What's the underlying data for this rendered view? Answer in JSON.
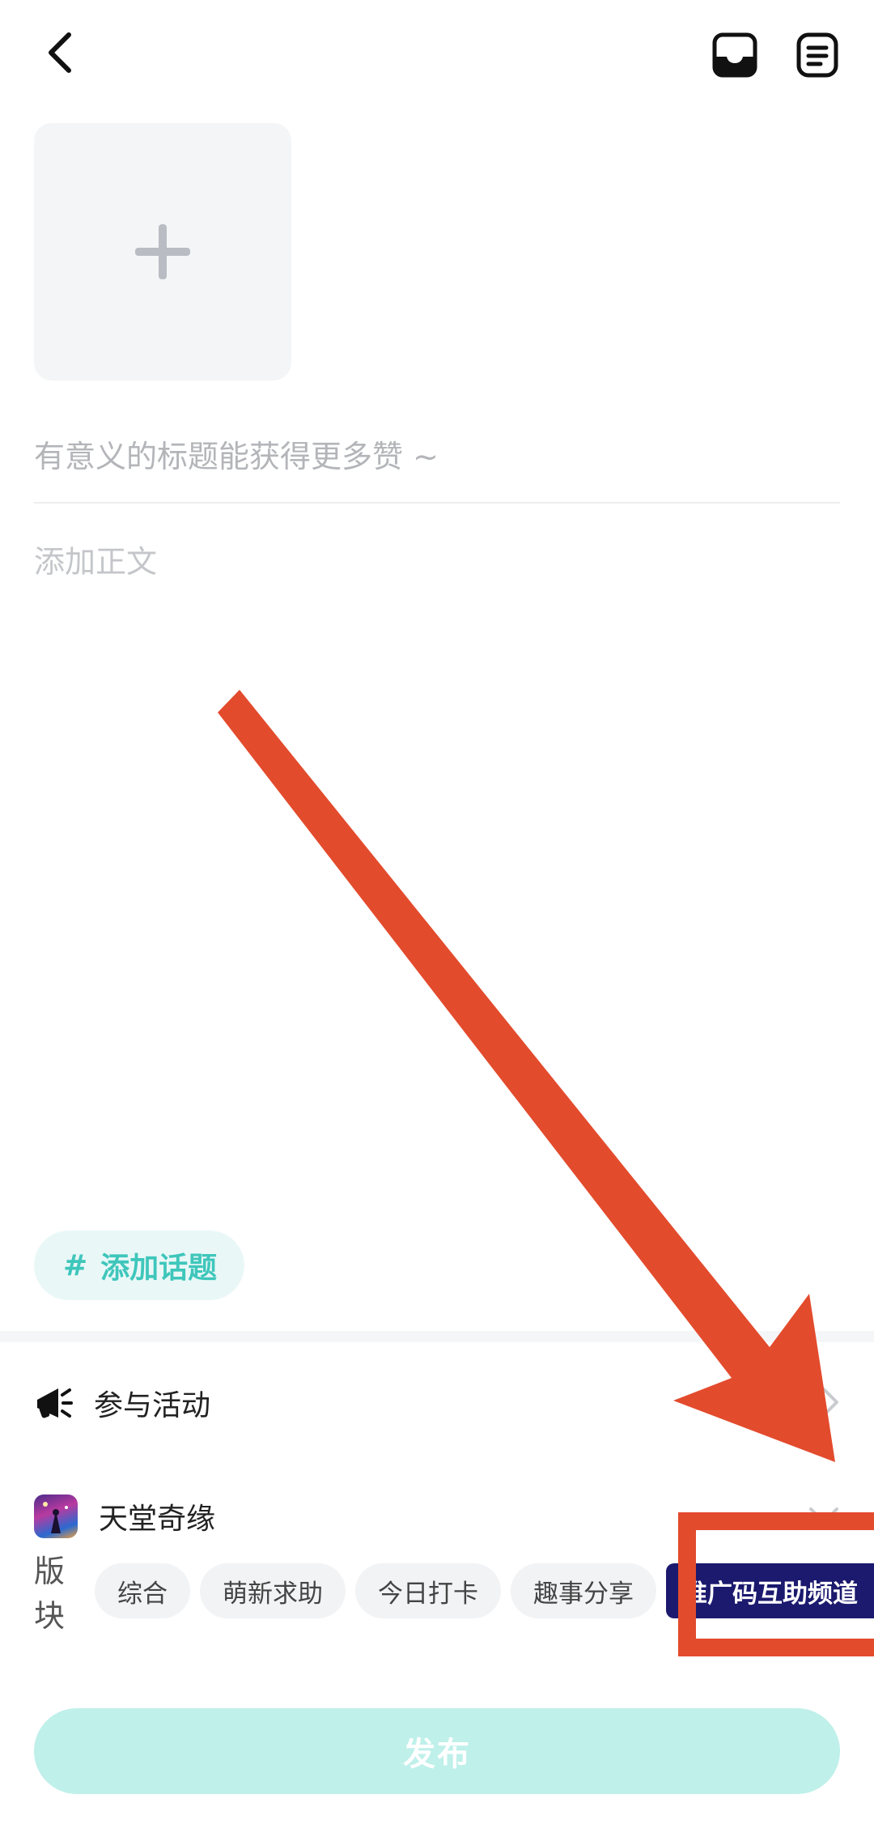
{
  "header": {
    "back_icon": "chevron-left-icon",
    "icons": [
      "inbox-icon",
      "draft-list-icon"
    ]
  },
  "editor": {
    "add_image_icon": "plus-icon",
    "title_placeholder": "有意义的标题能获得更多赞 ~",
    "body_placeholder": "添加正文"
  },
  "topic": {
    "hash": "#",
    "label": "添加话题",
    "color": "#3fc6bb"
  },
  "activity": {
    "icon": "megaphone-icon",
    "label": "参与活动"
  },
  "game": {
    "icon": "game-app-icon",
    "label": "天堂奇缘"
  },
  "board": {
    "label": "版块",
    "chips": [
      "综合",
      "萌新求助",
      "今日打卡",
      "趣事分享"
    ],
    "selected_chip": "推广码互助频道"
  },
  "publish": {
    "label": "发布",
    "color": "#bff0ea"
  },
  "annotation": {
    "color": "#e34b2d"
  }
}
